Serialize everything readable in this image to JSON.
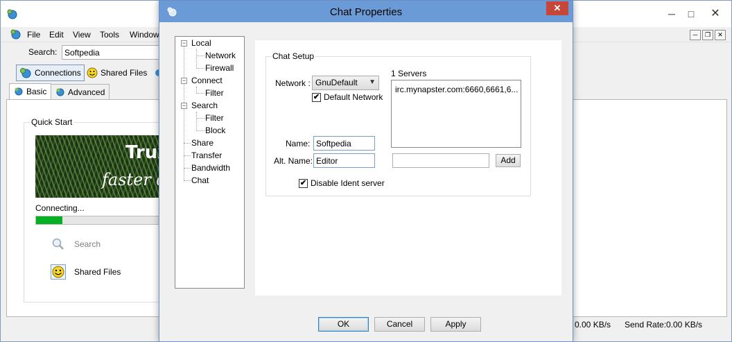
{
  "main": {
    "menu": [
      "File",
      "Edit",
      "View",
      "Tools",
      "Window"
    ],
    "search": {
      "label": "Search:",
      "value": "Softpedia"
    },
    "toolbar": {
      "connections": "Connections",
      "shared_files": "Shared Files"
    },
    "tabs": {
      "basic": "Basic",
      "advanced": "Advanced"
    },
    "quick_start": {
      "title": "Quick Start",
      "banner_title": "Trux",
      "banner_tagline": "faster d",
      "status": "Connecting...",
      "progress": 0.2,
      "search_label": "Search",
      "shared_files_label": "Shared Files"
    },
    "statusbar": {
      "receive_rate": "0.00 KB/s",
      "send_rate_label": "Send Rate:",
      "send_rate": "0.00 KB/s"
    }
  },
  "dialog": {
    "title": "Chat Properties",
    "tree": {
      "local": "Local",
      "network": "Network",
      "firewall": "Firewall",
      "connect": "Connect",
      "connect_filter": "Filter",
      "search": "Search",
      "search_filter": "Filter",
      "block": "Block",
      "share": "Share",
      "transfer": "Transfer",
      "bandwidth": "Bandwidth",
      "chat": "Chat"
    },
    "chat_setup": {
      "title": "Chat Setup",
      "network_label": "Network :",
      "network_value": "GnuDefault",
      "default_network_label": "Default Network",
      "default_network_checked": true,
      "servers_label": "1 Servers",
      "servers": [
        "irc.mynapster.com:6660,6661,6..."
      ],
      "name_label": "Name:",
      "name_value": "Softpedia",
      "alt_name_label": "Alt. Name:",
      "alt_name_value": "Editor",
      "new_server_value": "",
      "add_label": "Add",
      "disable_ident_label": "Disable Ident server",
      "disable_ident_checked": true
    },
    "buttons": {
      "ok": "OK",
      "cancel": "Cancel",
      "apply": "Apply"
    }
  }
}
